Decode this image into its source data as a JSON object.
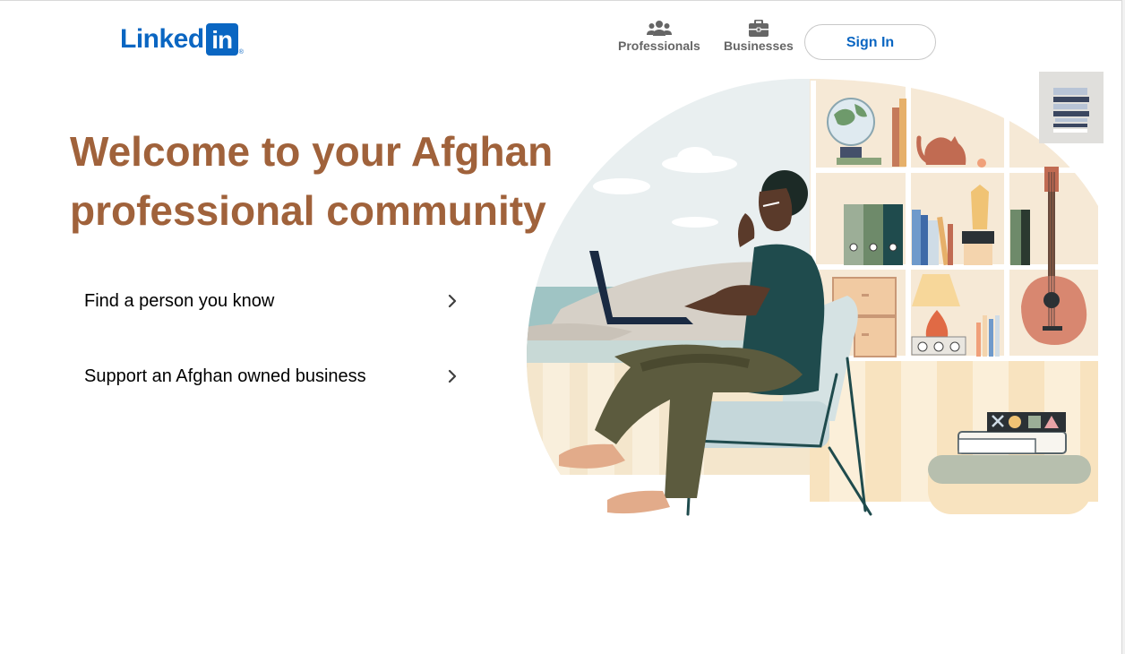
{
  "header": {
    "logo_text": "Linked",
    "logo_box_text": "in",
    "logo_registered": "®",
    "nav": [
      {
        "label": "Professionals",
        "icon": "people-icon"
      },
      {
        "label": "Businesses",
        "icon": "briefcase-icon"
      }
    ],
    "sign_in_label": "Sign In"
  },
  "hero": {
    "title": "Welcome to your Afghan professional community",
    "links": [
      {
        "label": "Find a person you know",
        "icon": "chevron-right-icon"
      },
      {
        "label": "Support an Afghan owned business",
        "icon": "chevron-right-icon"
      }
    ]
  },
  "colors": {
    "brand": "#0a66c2",
    "title": "#a0623b",
    "nav_text": "#666666"
  }
}
